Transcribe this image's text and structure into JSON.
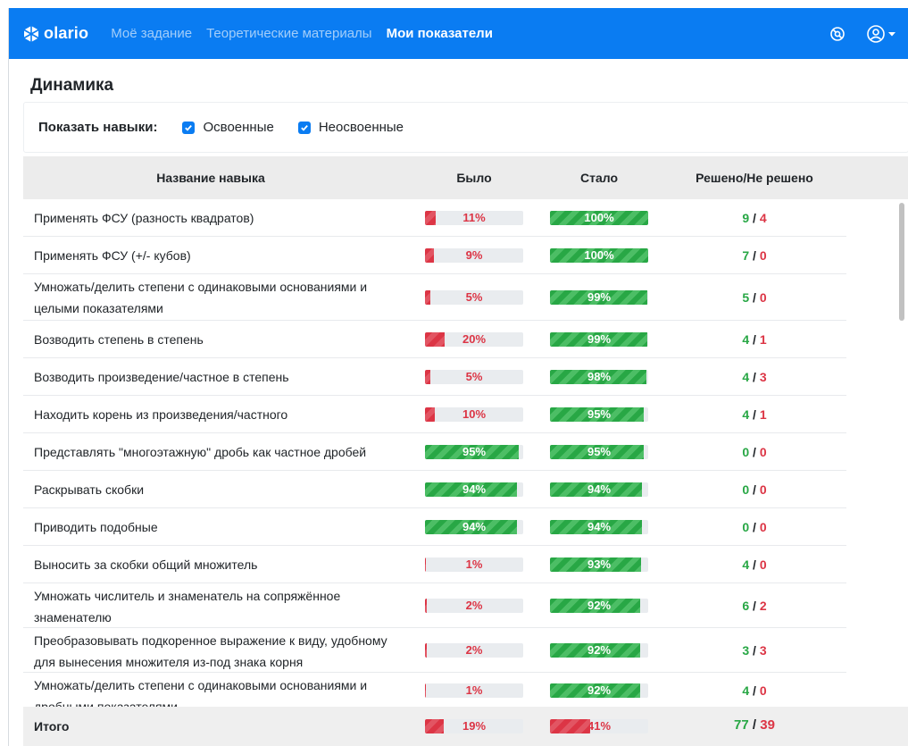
{
  "navbar": {
    "brand": "olario",
    "links": [
      "Моё задание",
      "Теоретические материалы",
      "Мои показатели"
    ],
    "active_index": 2,
    "icons": [
      "help-icon",
      "user-icon",
      "chevron-down-icon"
    ]
  },
  "page": {
    "title": "Динамика"
  },
  "filter": {
    "label": "Показать навыки:",
    "options": [
      {
        "label": "Освоенные",
        "checked": true
      },
      {
        "label": "Неосвоенные",
        "checked": true
      }
    ]
  },
  "table": {
    "headers": {
      "name": "Название навыка",
      "before": "Было",
      "after": "Стало",
      "score": "Решено/Не решено"
    },
    "rows": [
      {
        "name": "Применять ФСУ (разность квадратов)",
        "before": "11%",
        "before_value": 11,
        "after": "100%",
        "after_value": 100,
        "solved": "9",
        "unsolved": "4"
      },
      {
        "name": "Применять ФСУ (+/- кубов)",
        "before": "9%",
        "before_value": 9,
        "after": "100%",
        "after_value": 100,
        "solved": "7",
        "unsolved": "0"
      },
      {
        "name": "Умножать/делить степени с одинаковыми основаниями и целыми показателями",
        "before": "5%",
        "before_value": 5,
        "after": "99%",
        "after_value": 99,
        "solved": "5",
        "unsolved": "0"
      },
      {
        "name": "Возводить степень в степень",
        "before": "20%",
        "before_value": 20,
        "after": "99%",
        "after_value": 99,
        "solved": "4",
        "unsolved": "1"
      },
      {
        "name": "Возводить произведение/частное в степень",
        "before": "5%",
        "before_value": 5,
        "after": "98%",
        "after_value": 98,
        "solved": "4",
        "unsolved": "3"
      },
      {
        "name": "Находить корень из произведения/частного",
        "before": "10%",
        "before_value": 10,
        "after": "95%",
        "after_value": 95,
        "solved": "4",
        "unsolved": "1"
      },
      {
        "name": "Представлять \"многоэтажную\" дробь как частное дробей",
        "before": "95%",
        "before_value": 95,
        "after": "95%",
        "after_value": 95,
        "solved": "0",
        "unsolved": "0"
      },
      {
        "name": "Раскрывать скобки",
        "before": "94%",
        "before_value": 94,
        "after": "94%",
        "after_value": 94,
        "solved": "0",
        "unsolved": "0"
      },
      {
        "name": "Приводить подобные",
        "before": "94%",
        "before_value": 94,
        "after": "94%",
        "after_value": 94,
        "solved": "0",
        "unsolved": "0"
      },
      {
        "name": "Выносить за скобки общий множитель",
        "before": "1%",
        "before_value": 1,
        "after": "93%",
        "after_value": 93,
        "solved": "4",
        "unsolved": "0"
      },
      {
        "name": "Умножать числитель и знаменатель на сопряжённое знаменателю",
        "before": "2%",
        "before_value": 2,
        "after": "92%",
        "after_value": 92,
        "solved": "6",
        "unsolved": "2"
      },
      {
        "name": "Преобразовывать подкоренное выражение к виду, удобному для вынесения множителя из-под знака корня",
        "before": "2%",
        "before_value": 2,
        "after": "92%",
        "after_value": 92,
        "solved": "3",
        "unsolved": "3"
      },
      {
        "name": "Умножать/делить степени с одинаковыми основаниями и дробными показателями",
        "before": "1%",
        "before_value": 1,
        "after": "92%",
        "after_value": 92,
        "solved": "4",
        "unsolved": "0"
      }
    ],
    "total": {
      "name": "Итого",
      "before": "19%",
      "before_value": 19,
      "after": "41%",
      "after_value": 41,
      "solved": "77",
      "unsolved": "39"
    }
  },
  "colors": {
    "primary": "#0a7cf2",
    "success": "#28a745",
    "danger": "#dc3545",
    "header_bg": "#ececec"
  }
}
